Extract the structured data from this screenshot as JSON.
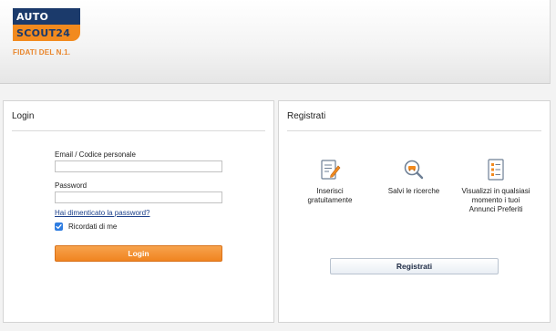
{
  "header": {
    "logo_line1": "AUTO",
    "logo_line2": "SCOUT24",
    "tagline": "FIDATI DEL N.1."
  },
  "login": {
    "title": "Login",
    "email_label": "Email / Codice personale",
    "email_value": "",
    "password_label": "Password",
    "password_value": "",
    "forgot_link": "Hai dimenticato la password?",
    "remember_label": "Ricordati di me",
    "remember_checked": true,
    "submit_label": "Login"
  },
  "register": {
    "title": "Registrati",
    "features": [
      {
        "icon": "document-pencil-icon",
        "text": "Inserisci gratuitamente"
      },
      {
        "icon": "magnifier-car-icon",
        "text": "Salvi le ricerche"
      },
      {
        "icon": "list-document-icon",
        "text": "Visualizzi in qualsiasi momento i tuoi Annunci Preferiti"
      }
    ],
    "submit_label": "Registrati"
  },
  "colors": {
    "brand_navy": "#1b3a6b",
    "brand_orange": "#f28a1e",
    "link_blue": "#1a3f8a",
    "checkbox_blue": "#2f7de1"
  }
}
